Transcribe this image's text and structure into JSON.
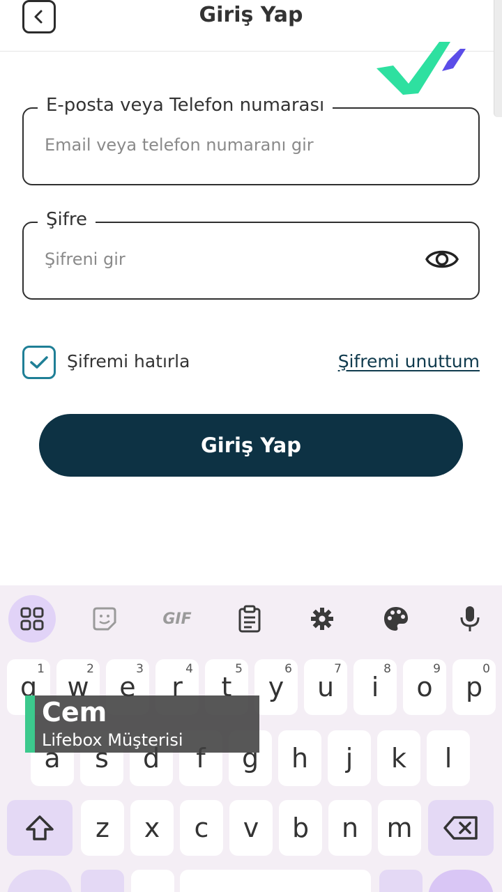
{
  "header": {
    "title": "Giriş Yap"
  },
  "form": {
    "email": {
      "label": "E-posta veya Telefon numarası",
      "placeholder": "Email veya telefon numaranı gir",
      "value": ""
    },
    "password": {
      "label": "Şifre",
      "placeholder": "Şifreni gir",
      "value": ""
    },
    "remember_label": "Şifremi hatırla",
    "remember_checked": true,
    "forgot_label": "Şifremi unuttum",
    "submit_label": "Giriş Yap"
  },
  "keyboard": {
    "toolbar": [
      "apps-grid-icon",
      "sticker-icon",
      "gif-icon",
      "clipboard-icon",
      "gear-icon",
      "palette-icon",
      "microphone-icon"
    ],
    "gif_label": "GIF",
    "row1": [
      {
        "key": "q",
        "hint": "1"
      },
      {
        "key": "w",
        "hint": "2"
      },
      {
        "key": "e",
        "hint": "3"
      },
      {
        "key": "r",
        "hint": "4"
      },
      {
        "key": "t",
        "hint": "5"
      },
      {
        "key": "y",
        "hint": "6"
      },
      {
        "key": "u",
        "hint": "7"
      },
      {
        "key": "i",
        "hint": "8"
      },
      {
        "key": "o",
        "hint": "9"
      },
      {
        "key": "p",
        "hint": "0"
      }
    ],
    "row2": [
      "a",
      "s",
      "d",
      "f",
      "g",
      "h",
      "j",
      "k",
      "l"
    ],
    "row3": [
      "z",
      "x",
      "c",
      "v",
      "b",
      "n",
      "m"
    ]
  },
  "caption": {
    "name": "Cem",
    "role": "Lifebox Müşterisi"
  },
  "colors": {
    "primary": "#0d3244",
    "accent": "#1f7f96",
    "logo_green": "#2ee0a0",
    "logo_purple": "#5b4de8"
  }
}
